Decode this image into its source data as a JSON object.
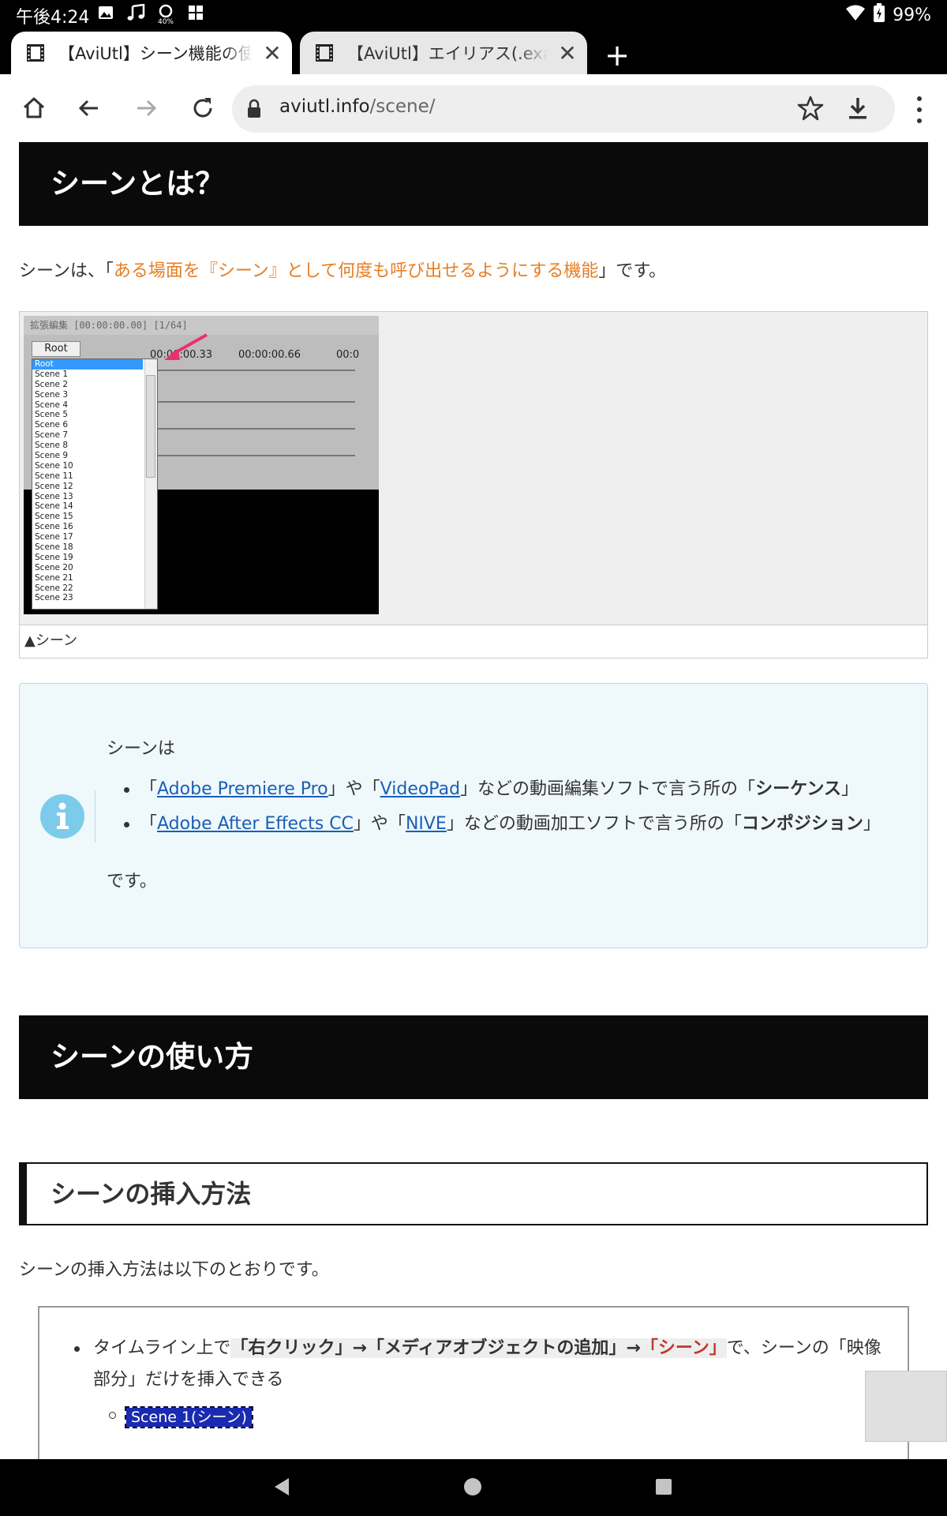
{
  "status_bar": {
    "time": "午後4:24",
    "battery": "99%",
    "icons": [
      "image-icon",
      "music-icon",
      "data-saver-icon",
      "flag-icon",
      "wifi-icon",
      "battery-icon"
    ]
  },
  "tabs": [
    {
      "title": "【AviUtl】シーン機能の使い方",
      "active": true
    },
    {
      "title": "【AviUtl】エイリアス(.exa)機能",
      "active": false
    }
  ],
  "toolbar": {
    "url_host": "aviutl.info",
    "url_path": "/scene/"
  },
  "content": {
    "h2_what_is": "シーンとは？",
    "intro": {
      "before": "シーンは、「",
      "highlight": "ある場面を『シーン』として何度も呼び出せるようにする機能",
      "after": "」です。"
    },
    "figure": {
      "window_title": "拡張編集 [00:00:00.00] [1/64]",
      "root_button": "Root",
      "ticks": [
        "00:00:00.33",
        "00:00:00.66",
        "00:0"
      ],
      "dropdown_items": [
        "Root",
        "Scene 1",
        "Scene 2",
        "Scene 3",
        "Scene 4",
        "Scene 5",
        "Scene 6",
        "Scene 7",
        "Scene 8",
        "Scene 9",
        "Scene 10",
        "Scene 11",
        "Scene 12",
        "Scene 13",
        "Scene 14",
        "Scene 15",
        "Scene 16",
        "Scene 17",
        "Scene 18",
        "Scene 19",
        "Scene 20",
        "Scene 21",
        "Scene 22",
        "Scene 23"
      ],
      "caption": "▲シーン"
    },
    "info": {
      "lead": "シーンは",
      "item1": {
        "q1": "「",
        "link1": "Adobe Premiere Pro",
        "mid1": "」や「",
        "link2": "VideoPad",
        "mid2": "」などの動画編集ソフトで言う所の「",
        "bold": "シーケンス",
        "end": "」"
      },
      "item2": {
        "q1": "「",
        "link1": "Adobe After Effects CC",
        "mid1": "」や「",
        "link2": "NIVE",
        "mid2": "」などの動画加工ソフトで言う所の「",
        "bold": "コンポジション",
        "end": "」"
      },
      "trail": "です。"
    },
    "h2_how_to": "シーンの使い方",
    "h3_insert": "シーンの挿入方法",
    "insert_intro": "シーンの挿入方法は以下のとおりです。",
    "list": {
      "prefix": "タイムライン上で",
      "step1": "「右クリック」→「メディアオブジェクトの追加」→",
      "step2": "「シーン」",
      "suffix": "で、シーンの「映像部分」だけを挿入できる",
      "sub_item": "Scene 1(シーン)"
    }
  }
}
